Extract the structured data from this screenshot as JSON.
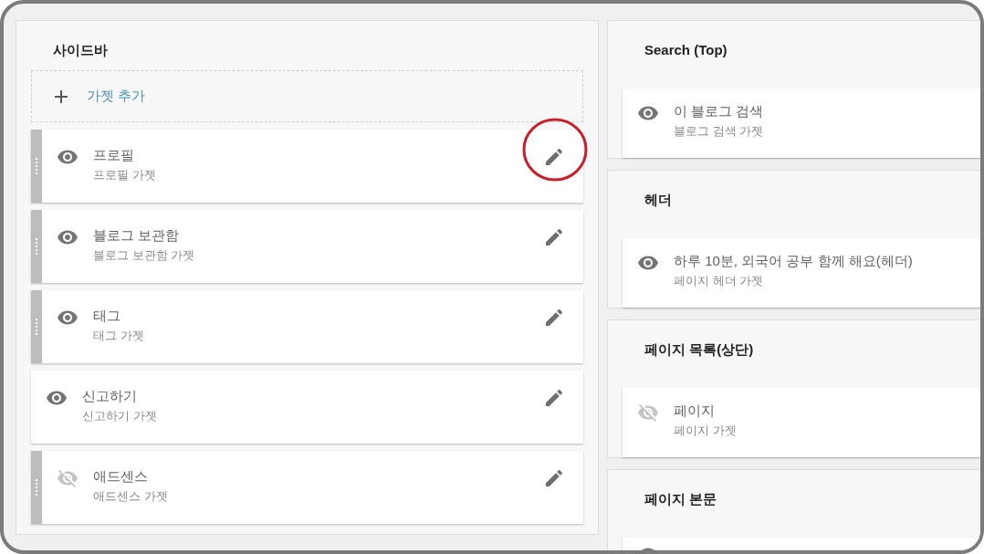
{
  "sidebar": {
    "title": "사이드바",
    "add_gadget": "가젯 추가",
    "gadgets": [
      {
        "title": "프로필",
        "subtitle": "프로필 가젯",
        "visible": true,
        "draggable": true,
        "highlighted": true
      },
      {
        "title": "블로그 보관함",
        "subtitle": "블로그 보관함 가젯",
        "visible": true,
        "draggable": true,
        "highlighted": false
      },
      {
        "title": "태그",
        "subtitle": "태그 가젯",
        "visible": true,
        "draggable": true,
        "highlighted": false
      },
      {
        "title": "신고하기",
        "subtitle": "신고하기 가젯",
        "visible": true,
        "draggable": false,
        "highlighted": false
      },
      {
        "title": "애드센스",
        "subtitle": "애드센스 가젯",
        "visible": false,
        "draggable": true,
        "highlighted": false
      }
    ]
  },
  "sections": [
    {
      "title": "Search (Top)",
      "gadgets": [
        {
          "title": "이 블로그 검색",
          "subtitle": "블로그 검색 가젯",
          "visible": true
        }
      ]
    },
    {
      "title": "헤더",
      "gadgets": [
        {
          "title": "하루 10분, 외국어 공부 함께 해요(헤더)",
          "subtitle": "페이지 헤더 가젯",
          "visible": true
        }
      ]
    },
    {
      "title": "페이지 목록(상단)",
      "gadgets": [
        {
          "title": "페이지",
          "subtitle": "페이지 가젯",
          "visible": false
        }
      ]
    },
    {
      "title": "페이지 본문",
      "gadgets": [
        {
          "visible": true
        }
      ]
    }
  ]
}
